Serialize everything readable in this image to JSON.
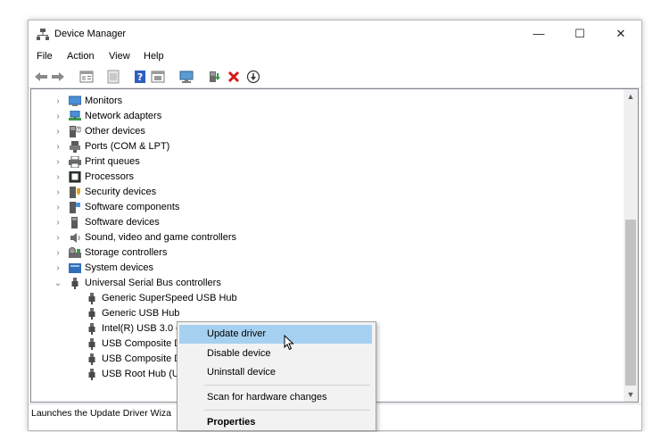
{
  "window": {
    "title": "Device Manager",
    "minimize": "—",
    "maximize": "☐",
    "close": "✕"
  },
  "menu": [
    "File",
    "Action",
    "View",
    "Help"
  ],
  "tree": {
    "items": [
      {
        "label": "Monitors",
        "icon": "monitor-icon",
        "expanded": false
      },
      {
        "label": "Network adapters",
        "icon": "network-adapter-icon",
        "expanded": false
      },
      {
        "label": "Other devices",
        "icon": "unknown-device-icon",
        "expanded": false
      },
      {
        "label": "Ports (COM & LPT)",
        "icon": "port-icon",
        "expanded": false
      },
      {
        "label": "Print queues",
        "icon": "printer-icon",
        "expanded": false
      },
      {
        "label": "Processors",
        "icon": "processor-icon",
        "expanded": false
      },
      {
        "label": "Security devices",
        "icon": "security-device-icon",
        "expanded": false
      },
      {
        "label": "Software components",
        "icon": "software-component-icon",
        "expanded": false
      },
      {
        "label": "Software devices",
        "icon": "software-device-icon",
        "expanded": false
      },
      {
        "label": "Sound, video and game controllers",
        "icon": "speaker-icon",
        "expanded": false
      },
      {
        "label": "Storage controllers",
        "icon": "storage-controller-icon",
        "expanded": false
      },
      {
        "label": "System devices",
        "icon": "system-device-icon",
        "expanded": false
      },
      {
        "label": "Universal Serial Bus controllers",
        "icon": "usb-icon",
        "expanded": true
      }
    ],
    "usb_children": [
      "Generic SuperSpeed USB Hub",
      "Generic USB Hub",
      "Intel(R) USB 3.0 e",
      "USB Composite D",
      "USB Composite D",
      "USB Root Hub (U"
    ]
  },
  "context_menu": {
    "items": [
      "Update driver",
      "Disable device",
      "Uninstall device",
      "Scan for hardware changes",
      "Properties"
    ],
    "highlighted": "Update driver"
  },
  "status_bar": "Launches the Update Driver Wiza",
  "colors": {
    "highlight": "#a6d0f0",
    "delete_red": "#d11a1a",
    "scroll_thumb": "#c2c2c2"
  }
}
